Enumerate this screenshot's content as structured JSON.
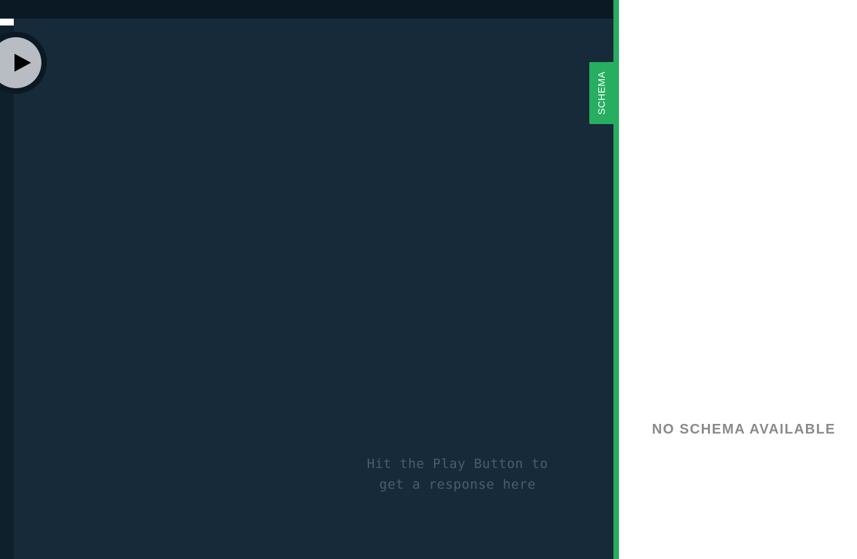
{
  "result": {
    "hint_line1": "Hit the Play Button to",
    "hint_line2": "get a response here"
  },
  "play_button": {
    "icon": "play-icon"
  },
  "schema": {
    "tab_label": "SCHEMA",
    "empty_message": "NO SCHEMA AVAILABLE",
    "accent_color": "#27ae60"
  },
  "colors": {
    "topbar": "#0b1924",
    "result_bg": "#172a3a",
    "editor_bg": "#0f202d",
    "hint_text": "#4d5c6a"
  }
}
